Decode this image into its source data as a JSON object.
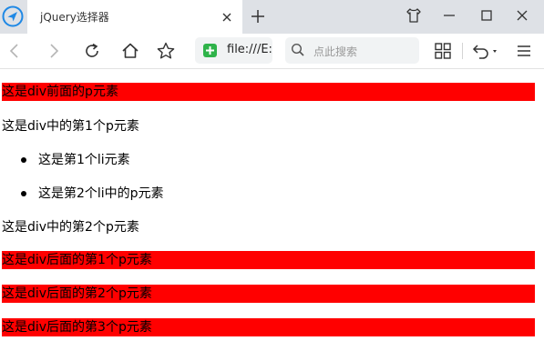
{
  "tab": {
    "title": "jQuery选择器"
  },
  "toolbar": {
    "url": "file:///E:/",
    "search_placeholder": "点此搜索"
  },
  "page": {
    "p_before": "这是div前面的p元素",
    "div_p1": "这是div中的第1个p元素",
    "li_items": [
      "这是第1个li元素",
      "这是第2个li中的p元素"
    ],
    "div_p2": "这是div中的第2个p元素",
    "p_after": [
      "这是div后面的第1个p元素",
      "这是div后面的第2个p元素",
      "这是div后面的第3个p元素"
    ]
  },
  "colors": {
    "highlight": "#ff0000",
    "tab_strip": "#dee1e6",
    "secure_badge": "#2fb34a"
  }
}
